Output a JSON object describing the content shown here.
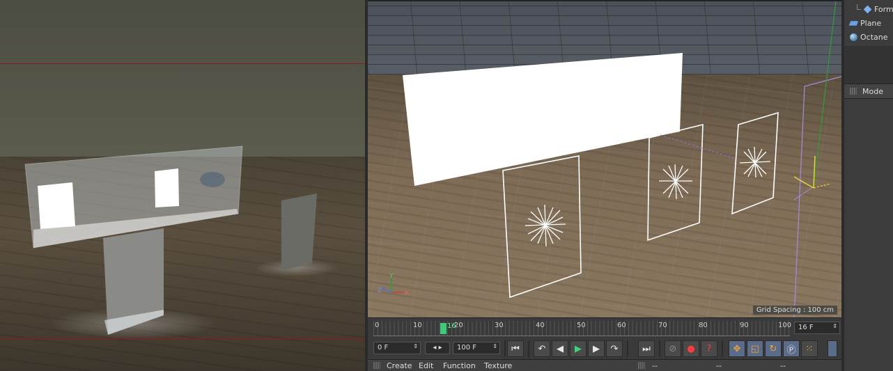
{
  "editor_view": {
    "grid_spacing_label": "Grid Spacing : 100 cm"
  },
  "timeline": {
    "ticks": [
      "0",
      "10",
      "20",
      "30",
      "40",
      "50",
      "60",
      "70",
      "80",
      "90",
      "100"
    ],
    "current_frame": "16",
    "current_frame_field": "16 F"
  },
  "transport": {
    "start_frame": "0 F",
    "end_frame": "100 F",
    "buttons": {
      "go_to_start": "⏮",
      "prev_key": "↶",
      "prev_frame": "◀",
      "play": "▶",
      "next_frame": "▶",
      "next_key": "↷",
      "go_to_end": "⏭"
    }
  },
  "bottom_menu": {
    "items": [
      "Create",
      "Edit",
      "Function",
      "Texture"
    ],
    "right_items": [
      "--",
      "--",
      "--"
    ]
  },
  "object_manager": {
    "items": [
      {
        "label": "Form",
        "icon": "form-icon"
      },
      {
        "label": "Plane",
        "icon": "plane-icon"
      },
      {
        "label": "Octane",
        "icon": "sky-sphere-icon"
      }
    ]
  },
  "attribute_manager": {
    "mode_label": "Mode"
  },
  "colors": {
    "guide_red": "#8a1d1d",
    "playhead_green": "#3fca7c",
    "axis_y": "#2f9e3a",
    "axis_x": "#d23c3c",
    "axis_z": "#4a6fd4",
    "bounding_box": "#a58ae0",
    "light_gizmo": "#ffffff"
  }
}
